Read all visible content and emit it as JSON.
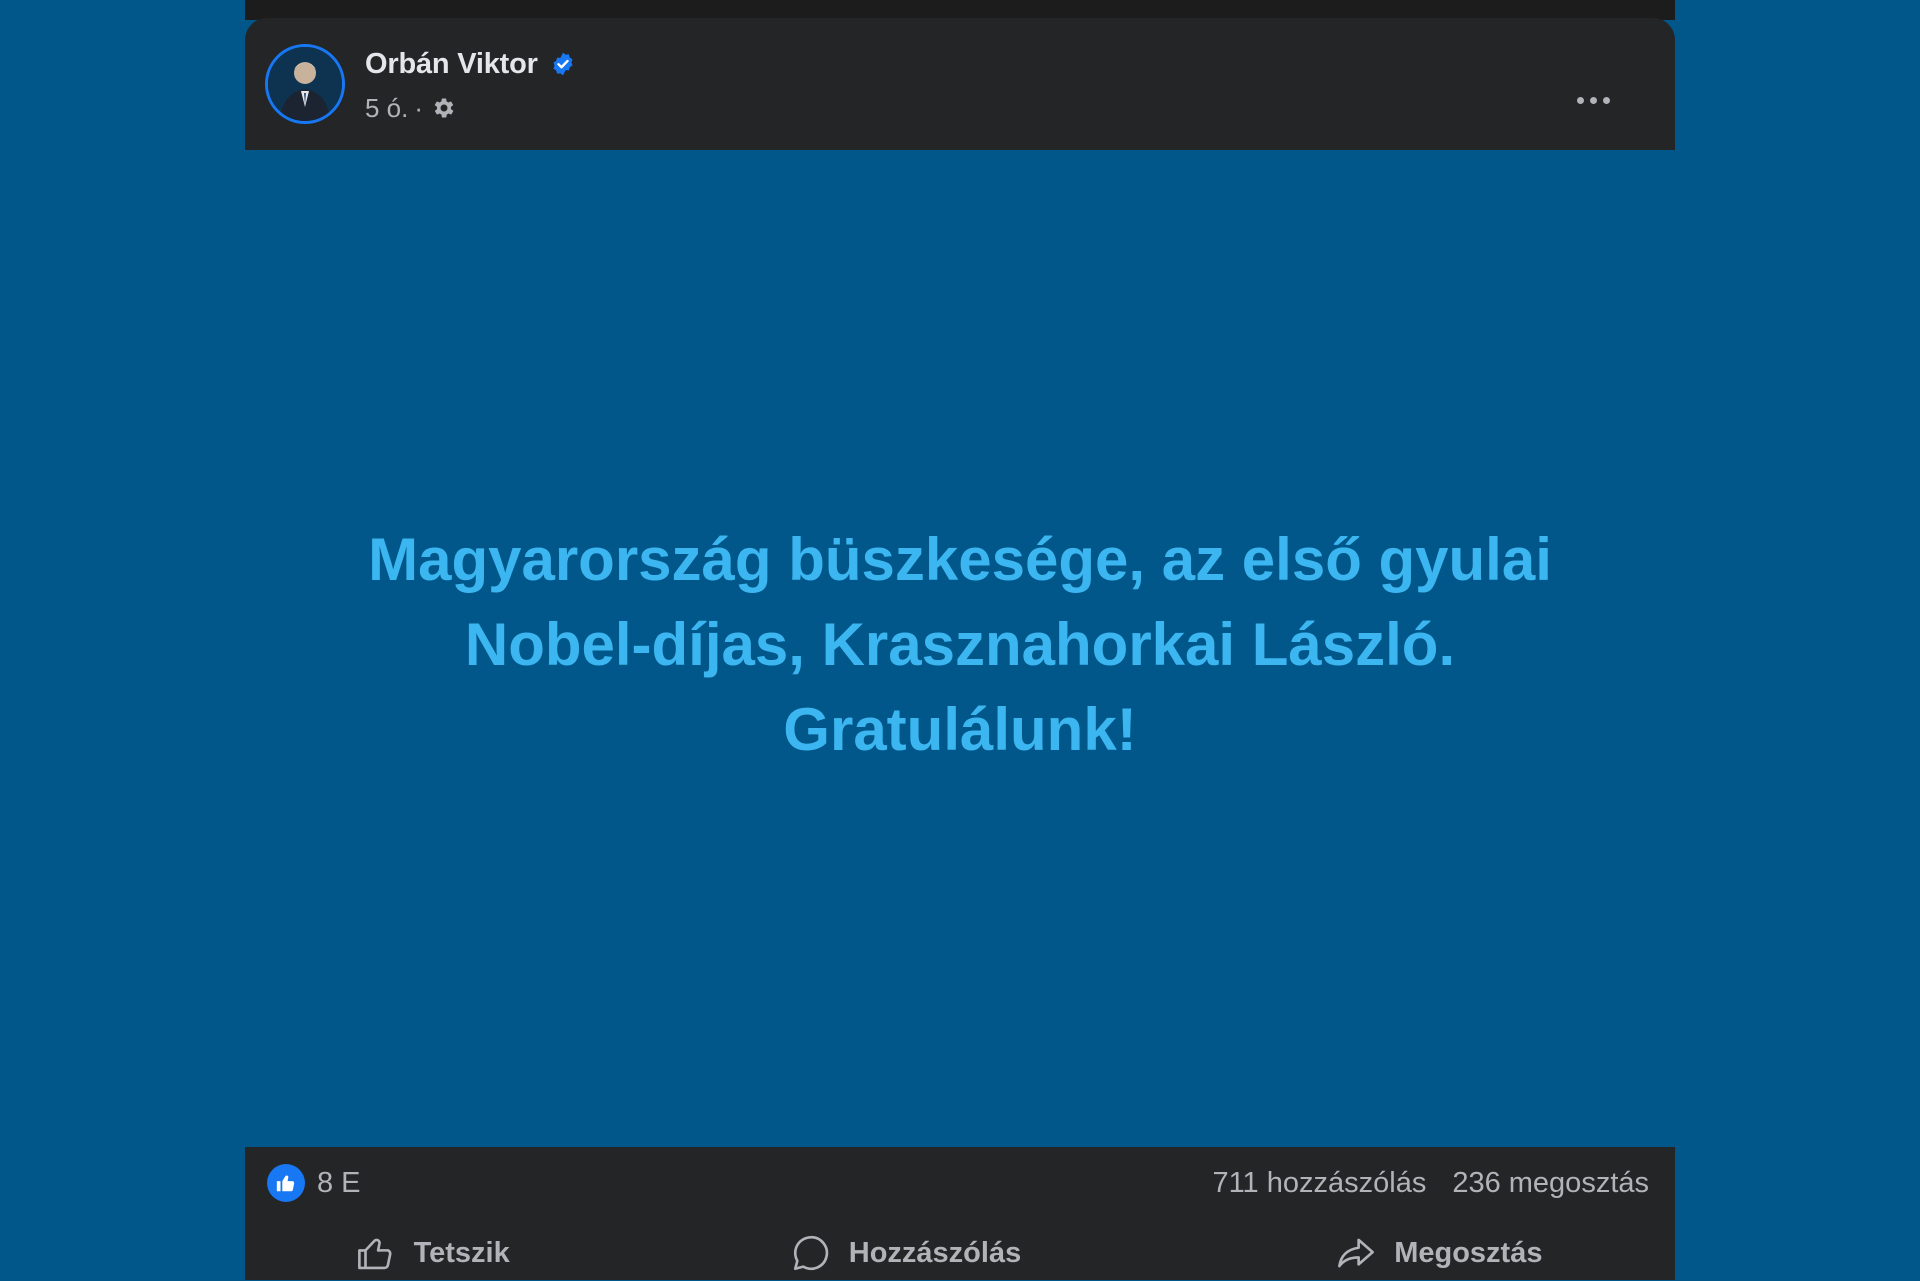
{
  "post": {
    "author": "Orbán Viktor",
    "time": "5 ó.",
    "separator": "·",
    "text_lines": [
      "Magyarország büszkesége, az első gyulai",
      "Nobel-díjas, Krasznahorkai László.",
      "Gratulálunk!"
    ],
    "reaction_count": "8 E",
    "comment_count": "711 hozzászólás",
    "share_count": "236 megosztás"
  },
  "actions": {
    "like": "Tetszik",
    "comment": "Hozzászólás",
    "share": "Megosztás"
  },
  "icons": {
    "verified": "verified-badge-icon",
    "audience": "gear-icon",
    "more": "more-options-icon",
    "like_reaction": "thumbs-up-icon",
    "like_action": "thumbs-up-outline-icon",
    "comment_action": "speech-bubble-icon",
    "share_action": "share-arrow-icon"
  },
  "colors": {
    "background": "#02578a",
    "card": "#242526",
    "post_text": "#3bb6f0",
    "accent": "#1877f2",
    "muted_text": "#b0b3b8",
    "name_text": "#e4e6eb"
  }
}
